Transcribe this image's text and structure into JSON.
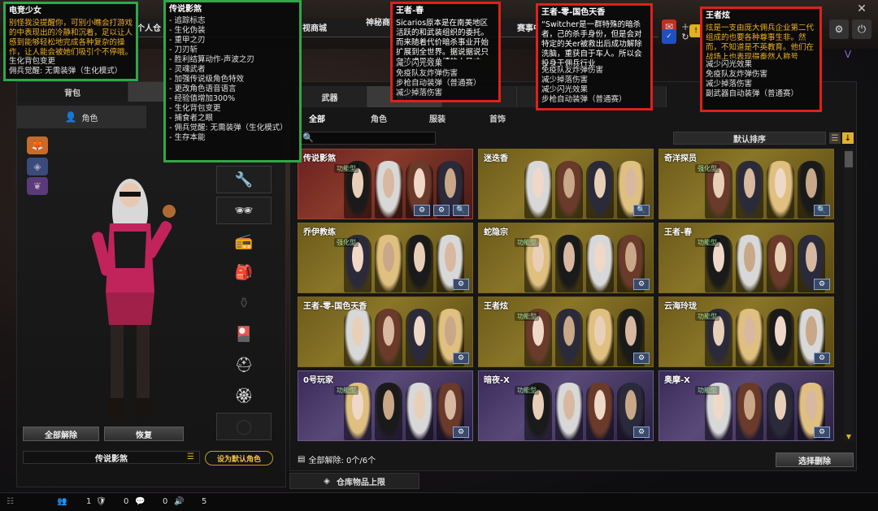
{
  "nav": {
    "items": [
      "个人仓",
      "视商城",
      "神秘商人启",
      "赛事中"
    ]
  },
  "left": {
    "tabs": [
      "背包",
      "角色"
    ],
    "subtab": "角色",
    "clear_all": "全部解除",
    "restore": "恢复",
    "current_name": "传说影煞",
    "set_default": "设为默认角色"
  },
  "main": {
    "tabs": [
      "武器",
      "角色",
      "",
      "",
      ""
    ],
    "filters": [
      "全部",
      "角色",
      "服装",
      "首饰"
    ],
    "search_placeholder": "",
    "sort_label": "默认排序",
    "count_label": "全部解除: 0个/6个",
    "dismantle_label": "选择删除",
    "warehouse_label": "仓库物品上限",
    "cards": [
      {
        "title": "传说影煞",
        "badge": "功能型",
        "style": "red"
      },
      {
        "title": "迷迭香",
        "badge": "",
        "style": "gold"
      },
      {
        "title": "奇洋探员",
        "badge": "强化型",
        "style": "gold"
      },
      {
        "title": "乔伊教练",
        "badge": "强化型",
        "style": "gold"
      },
      {
        "title": "蛇隐宗",
        "badge": "功能型",
        "style": "gold"
      },
      {
        "title": "王者-春",
        "badge": "功能型",
        "style": "gold"
      },
      {
        "title": "王者-零-国色天香",
        "badge": "",
        "style": "gold"
      },
      {
        "title": "王者炫",
        "badge": "功能型",
        "style": "gold"
      },
      {
        "title": "云海玲珑",
        "badge": "功能型",
        "style": "gold"
      },
      {
        "title": "0号玩家",
        "badge": "功能型",
        "style": "purple"
      },
      {
        "title": "暗夜-X",
        "badge": "功能型",
        "style": "purple"
      },
      {
        "title": "奥摩-X",
        "badge": "功能型",
        "style": "purple"
      }
    ]
  },
  "status": {
    "v1": "1",
    "v2": "0",
    "v3": "0",
    "v4": "5"
  },
  "tips": [
    {
      "title": "电竞少女",
      "body": "别怪我没提醒你，可别小瞧会打游戏的中表现出的冷静和沉着，足以让人感到能够轻松地完成各种复杂的操作，让人能会被她们吸引个不停哦。",
      "lines": [
        "生化背包变更",
        "佣兵觉醒: 无需装弹（生化模式）"
      ]
    },
    {
      "title": "传说影煞",
      "body": "",
      "lines": [
        "- 追踪标志",
        "- 生化伪装",
        "- 重甲之刃",
        "- 刀刃斩",
        "- 胜利结算动作-声波之刃",
        "- 灵魂武者",
        "- 加强传说级角色特效",
        "- 更改角色语音语言",
        "- 经验值增加300%",
        "- 生化背包变更",
        "- 捕食者之眼",
        "- 佣兵觉醒: 无需装弹（生化模式）",
        "- 生存本能"
      ]
    },
    {
      "title": "王者-春",
      "body": "Sicarios原本是在南美地区活跃的和武装组织的委托。而来随着代价暗杀事业开始扩展到全世界。据说据说只有达成最高业绩的人员才…",
      "lines": [
        "减少闪光效果",
        "免疫队友炸弹伤害",
        "步枪自动装弹（普通赛）",
        "减少掉落伤害"
      ]
    },
    {
      "title": "王者-零-国色天香",
      "body": "“Switcher是一群特殊的暗杀者，己的杀手身份，但是会对特定的关er被救出后成功解除洗脑，重获自于车人。所以会投身于佣兵行业",
      "lines": [
        "免疫队友炸弹伤害",
        "减少掉落伤害",
        "减少闪光效果",
        "步枪自动装弹（普通赛）"
      ]
    },
    {
      "title": "王者炫",
      "body": "炫是一支由庞大佣兵企业第二代组成的也要各种尊事生非。然而，不知道是不英教育。他们在战场上也表现得泰然人称号",
      "lines": [
        "减少闪光效果",
        "免疫队友炸弹伤害",
        "减少掉落伤害",
        "副武器自动装弹（普通赛）"
      ]
    }
  ]
}
